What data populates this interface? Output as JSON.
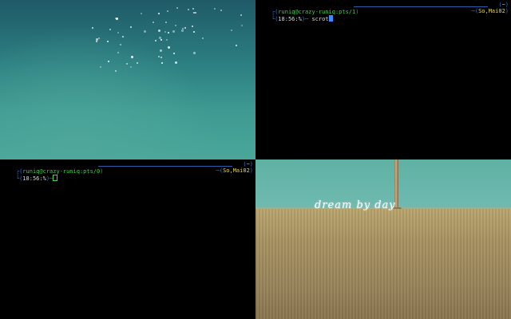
{
  "wallpaper_bottom_right": {
    "text": "dream by day"
  },
  "terminals": [
    {
      "id": "top-right",
      "title_open": "┌(",
      "user_host_tty": "runiq@crazy-runiq:pts/1",
      "title_close": ")",
      "dir_open": "(",
      "dir": "~",
      "dir_close": ")",
      "prompt_open": "└(",
      "time": "18:56",
      "sep": ":",
      "prompt_char": "%",
      "prompt_close": ")─",
      "command": " scrot",
      "date_open": "─(",
      "date": "So,Mai02",
      "date_close": ")"
    },
    {
      "id": "bottom-left",
      "title_open": "┌(",
      "user_host_tty": "runiq@crazy-runiq:pts/0",
      "title_close": ")",
      "dir_open": "(",
      "dir": "~",
      "dir_close": ")",
      "prompt_open": "└(",
      "time": "18:56",
      "sep": ":",
      "prompt_char": "%",
      "prompt_close": ")─",
      "command": "",
      "date_open": "─(",
      "date": "So,Mai02",
      "date_close": ")"
    }
  ],
  "colors": {
    "frame": "#2f7ad8",
    "user_host": "#3fd24a",
    "time": "#d8d8d8",
    "date": "#e8d440",
    "cursor": "#3d8bff"
  }
}
